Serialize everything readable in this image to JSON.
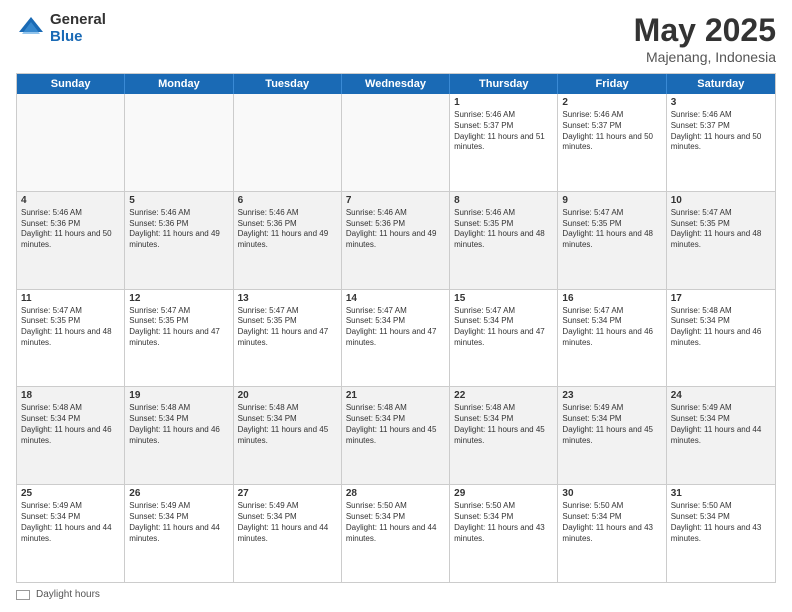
{
  "header": {
    "logo_general": "General",
    "logo_blue": "Blue",
    "title": "May 2025",
    "location": "Majenang, Indonesia"
  },
  "days_of_week": [
    "Sunday",
    "Monday",
    "Tuesday",
    "Wednesday",
    "Thursday",
    "Friday",
    "Saturday"
  ],
  "footer": {
    "daylight_label": "Daylight hours"
  },
  "weeks": [
    {
      "cells": [
        {
          "empty": true
        },
        {
          "empty": true
        },
        {
          "empty": true
        },
        {
          "empty": true
        },
        {
          "day": 1,
          "sunrise": "5:46 AM",
          "sunset": "5:37 PM",
          "daylight": "11 hours and 51 minutes."
        },
        {
          "day": 2,
          "sunrise": "5:46 AM",
          "sunset": "5:37 PM",
          "daylight": "11 hours and 50 minutes."
        },
        {
          "day": 3,
          "sunrise": "5:46 AM",
          "sunset": "5:37 PM",
          "daylight": "11 hours and 50 minutes."
        }
      ]
    },
    {
      "cells": [
        {
          "day": 4,
          "sunrise": "5:46 AM",
          "sunset": "5:36 PM",
          "daylight": "11 hours and 50 minutes."
        },
        {
          "day": 5,
          "sunrise": "5:46 AM",
          "sunset": "5:36 PM",
          "daylight": "11 hours and 49 minutes."
        },
        {
          "day": 6,
          "sunrise": "5:46 AM",
          "sunset": "5:36 PM",
          "daylight": "11 hours and 49 minutes."
        },
        {
          "day": 7,
          "sunrise": "5:46 AM",
          "sunset": "5:36 PM",
          "daylight": "11 hours and 49 minutes."
        },
        {
          "day": 8,
          "sunrise": "5:46 AM",
          "sunset": "5:35 PM",
          "daylight": "11 hours and 48 minutes."
        },
        {
          "day": 9,
          "sunrise": "5:47 AM",
          "sunset": "5:35 PM",
          "daylight": "11 hours and 48 minutes."
        },
        {
          "day": 10,
          "sunrise": "5:47 AM",
          "sunset": "5:35 PM",
          "daylight": "11 hours and 48 minutes."
        }
      ]
    },
    {
      "cells": [
        {
          "day": 11,
          "sunrise": "5:47 AM",
          "sunset": "5:35 PM",
          "daylight": "11 hours and 48 minutes."
        },
        {
          "day": 12,
          "sunrise": "5:47 AM",
          "sunset": "5:35 PM",
          "daylight": "11 hours and 47 minutes."
        },
        {
          "day": 13,
          "sunrise": "5:47 AM",
          "sunset": "5:35 PM",
          "daylight": "11 hours and 47 minutes."
        },
        {
          "day": 14,
          "sunrise": "5:47 AM",
          "sunset": "5:34 PM",
          "daylight": "11 hours and 47 minutes."
        },
        {
          "day": 15,
          "sunrise": "5:47 AM",
          "sunset": "5:34 PM",
          "daylight": "11 hours and 47 minutes."
        },
        {
          "day": 16,
          "sunrise": "5:47 AM",
          "sunset": "5:34 PM",
          "daylight": "11 hours and 46 minutes."
        },
        {
          "day": 17,
          "sunrise": "5:48 AM",
          "sunset": "5:34 PM",
          "daylight": "11 hours and 46 minutes."
        }
      ]
    },
    {
      "cells": [
        {
          "day": 18,
          "sunrise": "5:48 AM",
          "sunset": "5:34 PM",
          "daylight": "11 hours and 46 minutes."
        },
        {
          "day": 19,
          "sunrise": "5:48 AM",
          "sunset": "5:34 PM",
          "daylight": "11 hours and 46 minutes."
        },
        {
          "day": 20,
          "sunrise": "5:48 AM",
          "sunset": "5:34 PM",
          "daylight": "11 hours and 45 minutes."
        },
        {
          "day": 21,
          "sunrise": "5:48 AM",
          "sunset": "5:34 PM",
          "daylight": "11 hours and 45 minutes."
        },
        {
          "day": 22,
          "sunrise": "5:48 AM",
          "sunset": "5:34 PM",
          "daylight": "11 hours and 45 minutes."
        },
        {
          "day": 23,
          "sunrise": "5:49 AM",
          "sunset": "5:34 PM",
          "daylight": "11 hours and 45 minutes."
        },
        {
          "day": 24,
          "sunrise": "5:49 AM",
          "sunset": "5:34 PM",
          "daylight": "11 hours and 44 minutes."
        }
      ]
    },
    {
      "cells": [
        {
          "day": 25,
          "sunrise": "5:49 AM",
          "sunset": "5:34 PM",
          "daylight": "11 hours and 44 minutes."
        },
        {
          "day": 26,
          "sunrise": "5:49 AM",
          "sunset": "5:34 PM",
          "daylight": "11 hours and 44 minutes."
        },
        {
          "day": 27,
          "sunrise": "5:49 AM",
          "sunset": "5:34 PM",
          "daylight": "11 hours and 44 minutes."
        },
        {
          "day": 28,
          "sunrise": "5:50 AM",
          "sunset": "5:34 PM",
          "daylight": "11 hours and 44 minutes."
        },
        {
          "day": 29,
          "sunrise": "5:50 AM",
          "sunset": "5:34 PM",
          "daylight": "11 hours and 43 minutes."
        },
        {
          "day": 30,
          "sunrise": "5:50 AM",
          "sunset": "5:34 PM",
          "daylight": "11 hours and 43 minutes."
        },
        {
          "day": 31,
          "sunrise": "5:50 AM",
          "sunset": "5:34 PM",
          "daylight": "11 hours and 43 minutes."
        }
      ]
    }
  ]
}
